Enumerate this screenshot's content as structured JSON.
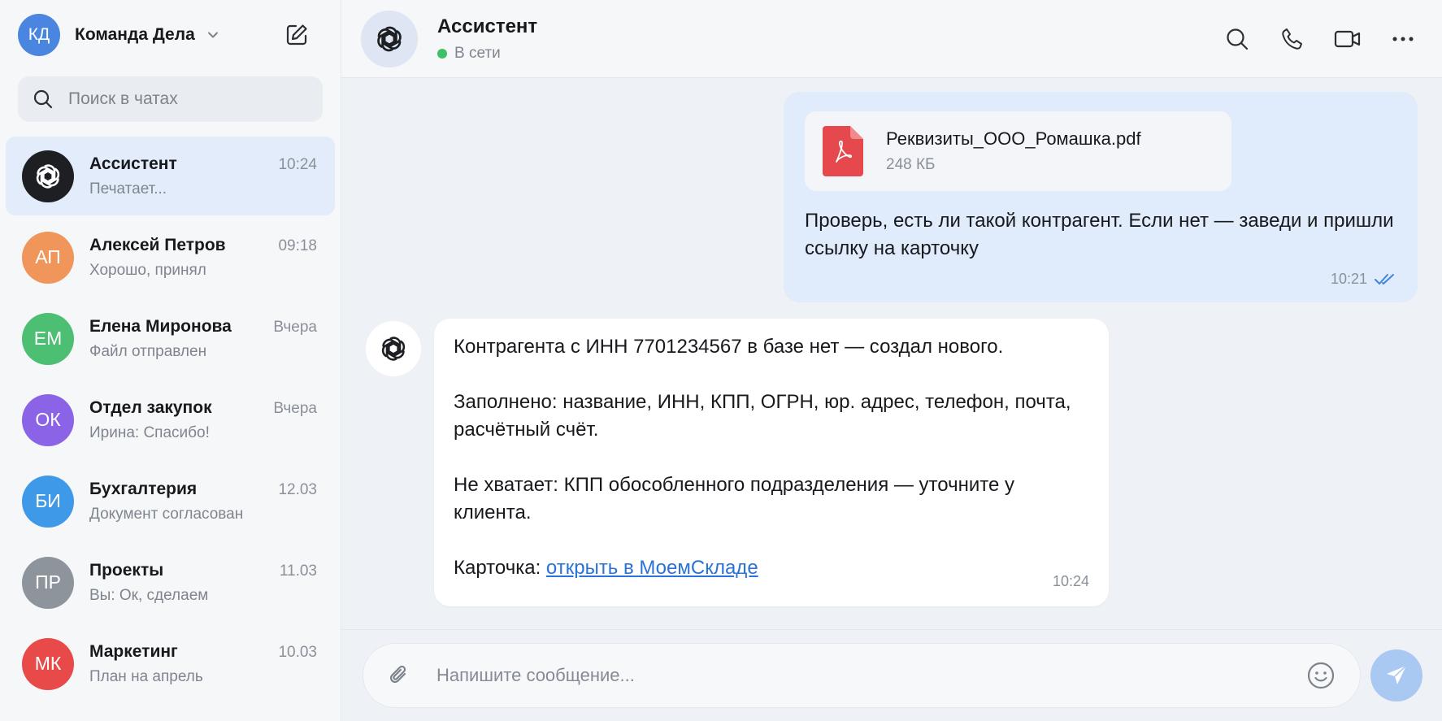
{
  "workspace": {
    "initials": "КД",
    "name": "Команда Дела",
    "avatar_color": "#4a86e0"
  },
  "search": {
    "placeholder": "Поиск в чатах"
  },
  "chats": [
    {
      "name": "Ассистент",
      "time": "10:24",
      "preview": "Печатает...",
      "initials": "",
      "color": "#1e1f23",
      "active": true,
      "icon": "openai-logo-icon"
    },
    {
      "name": "Алексей Петров",
      "time": "09:18",
      "preview": "Хорошо, принял",
      "initials": "АП",
      "color": "#f0965a"
    },
    {
      "name": "Елена Миронова",
      "time": "Вчера",
      "preview": "Файл отправлен",
      "initials": "ЕМ",
      "color": "#4cbf72"
    },
    {
      "name": "Отдел закупок",
      "time": "Вчера",
      "preview": "Ирина: Спасибо!",
      "initials": "ОК",
      "color": "#8a63e6"
    },
    {
      "name": "Бухгалтерия",
      "time": "12.03",
      "preview": "Документ согласован",
      "initials": "БИ",
      "color": "#3e9ae8"
    },
    {
      "name": "Проекты",
      "time": "11.03",
      "preview": "Вы: Ок, сделаем",
      "initials": "ПР",
      "color": "#8e949c"
    },
    {
      "name": "Маркетинг",
      "time": "10.03",
      "preview": "План на апрель",
      "initials": "МК",
      "color": "#e84a4a"
    }
  ],
  "header": {
    "name": "Ассистент",
    "status": "В сети",
    "status_color": "#3fbf6a"
  },
  "messages": {
    "outgoing": {
      "file_name": "Реквизиты_ООО_Ромашка.pdf",
      "file_size": "248 КБ",
      "text": "Проверь, есть ли такой контрагент. Если нет — заведи и пришли ссылку на карточку",
      "time": "10:21"
    },
    "incoming": {
      "line1": "Контрагента с ИНН 7701234567 в базе нет — создал нового.",
      "line2": "Заполнено: название, ИНН, КПП, ОГРН, юр. адрес, телефон, почта, расчётный счёт.",
      "line3": "Не хватает: КПП обособленного подразделения — уточните у клиента.",
      "card_label": "Карточка: ",
      "card_link": "открыть в МоемСкладе",
      "time": "10:24"
    }
  },
  "composer": {
    "placeholder": "Напишите сообщение..."
  },
  "colors": {
    "accent": "#2a73d6",
    "active_chat_bg": "#e3ecfa",
    "outgoing_bubble": "#e0ebfb",
    "send_button": "#a9c8f2",
    "pdf_red": "#e5484d"
  }
}
